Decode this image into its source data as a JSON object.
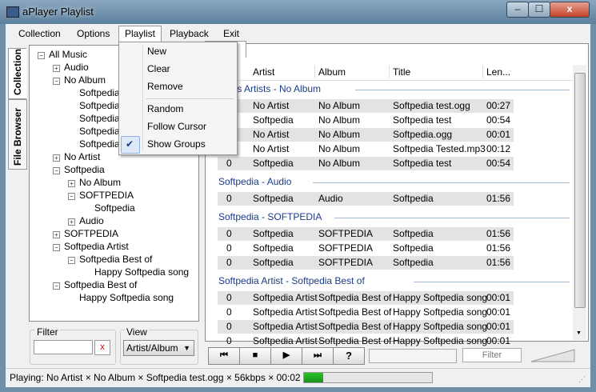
{
  "window": {
    "title": "aPlayer Playlist",
    "min": "–",
    "max": "☐",
    "close": "x"
  },
  "menubar": {
    "items": [
      "Collection",
      "Options",
      "Playlist",
      "Playback",
      "Exit"
    ]
  },
  "playlist_menu": {
    "items": [
      "New",
      "Clear",
      "Remove",
      "Random",
      "Follow Cursor",
      "Show Groups"
    ],
    "checked": "✔"
  },
  "sidetabs": {
    "collection": "Collection",
    "file_browser": "File Browser"
  },
  "tree": [
    {
      "label": "All Music",
      "level": 0,
      "exp": "−"
    },
    {
      "label": "Audio",
      "level": 1,
      "exp": "+"
    },
    {
      "label": "No Album",
      "level": 1,
      "exp": "−"
    },
    {
      "label": "Softpedia",
      "level": 2
    },
    {
      "label": "Softpedia",
      "level": 2
    },
    {
      "label": "Softpedia",
      "level": 2
    },
    {
      "label": "Softpedia",
      "level": 2
    },
    {
      "label": "Softpedia",
      "level": 2
    },
    {
      "label": "No Artist",
      "level": 1,
      "exp": "+"
    },
    {
      "label": "Softpedia",
      "level": 1,
      "exp": "−"
    },
    {
      "label": "No Album",
      "level": 2,
      "exp": "+"
    },
    {
      "label": "SOFTPEDIA",
      "level": 2,
      "exp": "−"
    },
    {
      "label": "Softpedia",
      "level": 3
    },
    {
      "label": "Audio",
      "level": 2,
      "exp": "+"
    },
    {
      "label": "SOFTPEDIA",
      "level": 1,
      "exp": "+"
    },
    {
      "label": "Softpedia Artist",
      "level": 1,
      "exp": "−"
    },
    {
      "label": "Softpedia Best of",
      "level": 2,
      "exp": "−"
    },
    {
      "label": "Happy Softpedia song",
      "level": 3
    },
    {
      "label": "Softpedia Best of",
      "level": 1,
      "exp": "−"
    },
    {
      "label": "Happy Softpedia song",
      "level": 2
    }
  ],
  "filter": {
    "label": "Filter",
    "clear": "x",
    "value": ""
  },
  "view": {
    "label": "View",
    "selected": "Artist/Album"
  },
  "playlist": {
    "columns": [
      "Artist",
      "Album",
      "Title",
      "Len..."
    ],
    "groups": [
      {
        "name": "...ous Artists - No Album",
        "rows": [
          [
            "0",
            "No Artist",
            "No Album",
            "Softpedia test.ogg",
            "00:27"
          ],
          [
            "0",
            "Softpedia",
            "No Album",
            "Softpedia test",
            "00:54"
          ],
          [
            "0",
            "No Artist",
            "No Album",
            "Softpedia.ogg",
            "00:01"
          ],
          [
            "0",
            "No Artist",
            "No Album",
            "Softpedia Tested.mp3",
            "00:12"
          ],
          [
            "0",
            "Softpedia",
            "No Album",
            "Softpedia test",
            "00:54"
          ]
        ]
      },
      {
        "name": "Softpedia - Audio",
        "rows": [
          [
            "0",
            "Softpedia",
            "Audio",
            "Softpedia",
            "01:56"
          ]
        ]
      },
      {
        "name": "Softpedia - SOFTPEDIA",
        "rows": [
          [
            "0",
            "Softpedia",
            "SOFTPEDIA",
            "Softpedia",
            "01:56"
          ],
          [
            "0",
            "Softpedia",
            "SOFTPEDIA",
            "Softpedia",
            "01:56"
          ],
          [
            "0",
            "Softpedia",
            "SOFTPEDIA",
            "Softpedia",
            "01:56"
          ]
        ]
      },
      {
        "name": "Softpedia Artist - Softpedia Best of",
        "rows": [
          [
            "0",
            "Softpedia Artist",
            "Softpedia Best of",
            "Happy Softpedia song",
            "00:01"
          ],
          [
            "0",
            "Softpedia Artist",
            "Softpedia Best of",
            "Happy Softpedia song",
            "00:01"
          ],
          [
            "0",
            "Softpedia Artist",
            "Softpedia Best of",
            "Happy Softpedia song",
            "00:01"
          ],
          [
            "0",
            "Softpedia Artist",
            "Softpedia Best of",
            "Happy Softpedia song",
            "00:01"
          ]
        ]
      }
    ]
  },
  "transport": {
    "prev": "⏮",
    "stop": "■",
    "play": "▶",
    "next": "⏭",
    "help": "?",
    "filter_placeholder": "Filter"
  },
  "status": {
    "text": "Playing: No Artist × No Album × Softpedia test.ogg × 56kbps × 00:02",
    "progress": 0.15
  },
  "colors": {
    "group": "#1a3b8a",
    "progress": "#29c429"
  }
}
